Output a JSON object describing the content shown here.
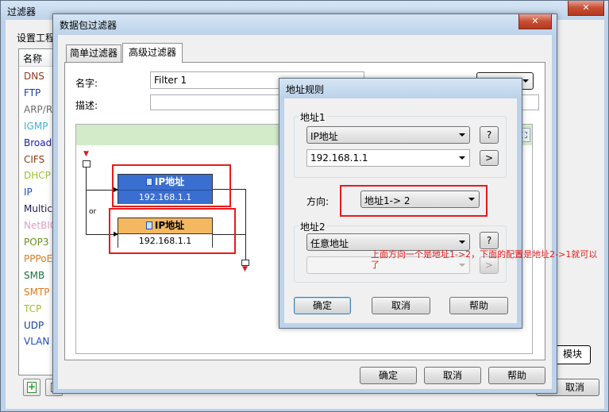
{
  "outer_window": {
    "title": "过滤器",
    "section_label": "设置工程",
    "list_header": "名称",
    "protocols": [
      {
        "name": "DNS",
        "color": "#8b3a1a"
      },
      {
        "name": "FTP",
        "color": "#1a3f99"
      },
      {
        "name": "ARP/RA",
        "color": "#6a6a6a"
      },
      {
        "name": "IGMP",
        "color": "#3fb3c7"
      },
      {
        "name": "Broadc",
        "color": "#1a1ab0"
      },
      {
        "name": "CIFS",
        "color": "#8b3a1a"
      },
      {
        "name": "DHCP",
        "color": "#9fbf2f"
      },
      {
        "name": "IP",
        "color": "#1a4fbf"
      },
      {
        "name": "Multica",
        "color": "#1a1a4f"
      },
      {
        "name": "NetBIO",
        "color": "#e0a0c0"
      },
      {
        "name": "POP3",
        "color": "#6a8a1a"
      },
      {
        "name": "PPPoE",
        "color": "#e07a1a"
      },
      {
        "name": "SMB",
        "color": "#1a6f3f"
      },
      {
        "name": "SMTP",
        "color": "#e07a1a"
      },
      {
        "name": "TCP",
        "color": "#9fbf2f"
      },
      {
        "name": "UDP",
        "color": "#1a3f99"
      },
      {
        "name": "VLAN 8",
        "color": "#1a4fbf"
      }
    ],
    "module_button": "模块",
    "cancel_button": "取消"
  },
  "packet_filter": {
    "title": "数据包过滤器",
    "tabs": [
      "简单过滤器",
      "高级过滤器"
    ],
    "name_label": "名字:",
    "name_value": "Filter 1",
    "desc_label": "描述:",
    "desc_value": "",
    "or_label": "or",
    "node1": {
      "title": "IP地址",
      "ip": "192.168.1.1",
      "color": "#3a6ed0"
    },
    "node2": {
      "title": "IP地址",
      "ip": "192.168.1.1",
      "color": "#f3b860"
    },
    "ok_button": "确定",
    "cancel_button": "取消",
    "help_button": "帮助"
  },
  "address_rule": {
    "title": "地址规则",
    "addr1_label": "地址1",
    "addr1_type": "IP地址",
    "addr1_value": "192.168.1.1",
    "help_q": "?",
    "more": ">",
    "direction_label": "方向:",
    "direction_value": "地址1-> 2",
    "addr2_label": "地址2",
    "addr2_type": "任意地址",
    "addr2_value": "",
    "ok_button": "确定",
    "cancel_button": "取消",
    "help_button": "帮助"
  },
  "annotation": "上面方向一个是地址1->2，下面的配置是地址2->1就可以了"
}
